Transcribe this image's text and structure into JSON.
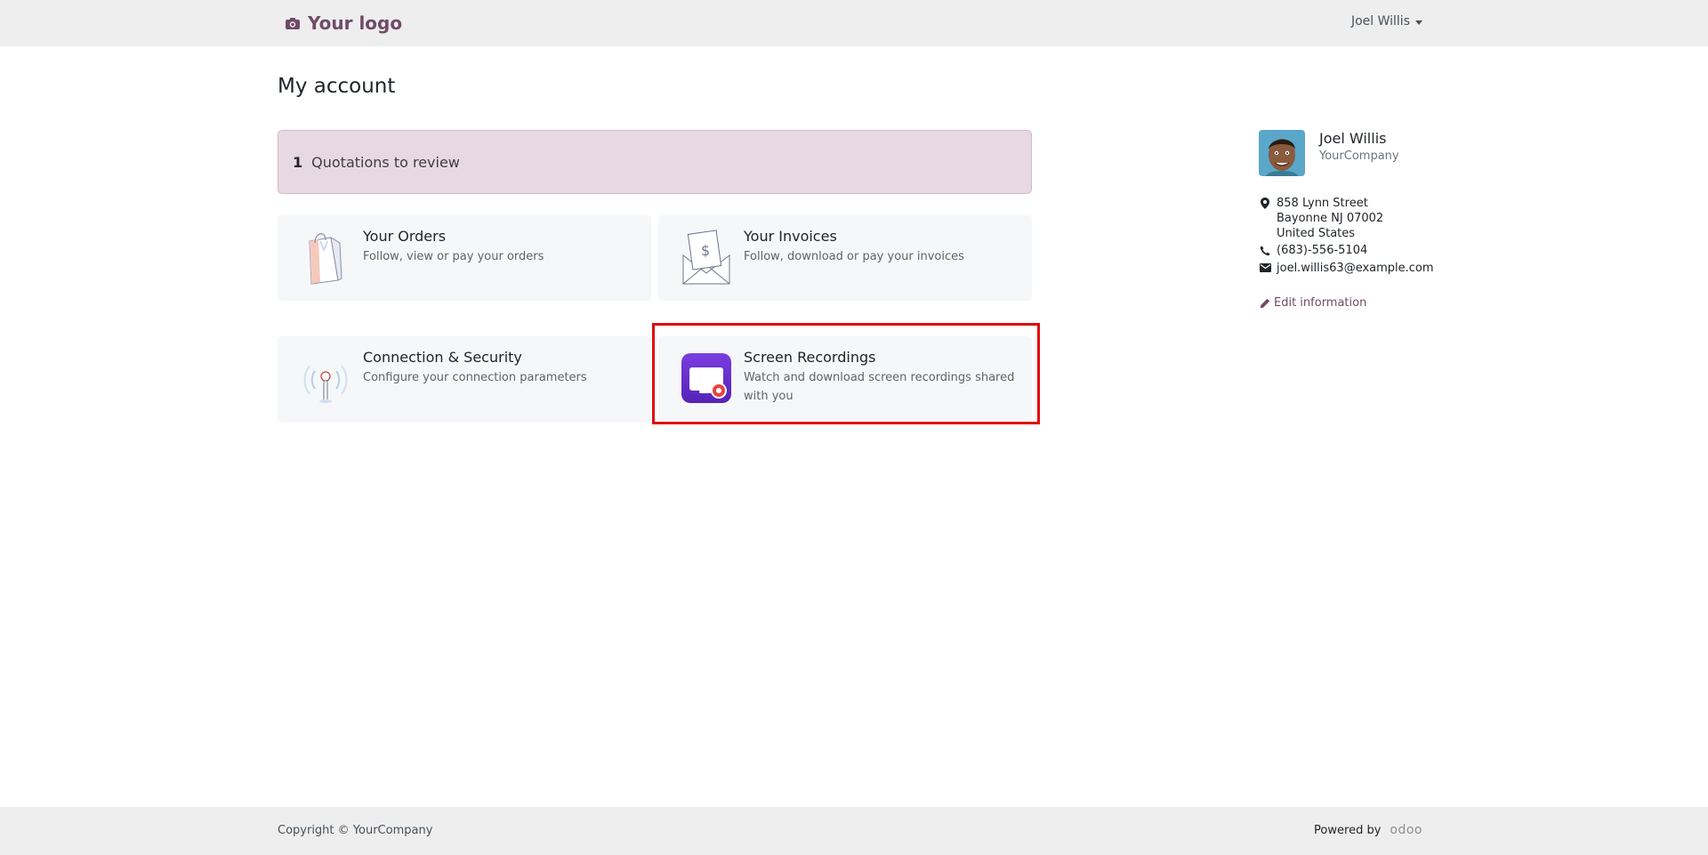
{
  "header": {
    "logo_text": "Your logo",
    "user_name": "Joel Willis"
  },
  "page": {
    "title": "My account"
  },
  "alert": {
    "count": "1",
    "label": "Quotations to review"
  },
  "cards": [
    {
      "title": "Your Orders",
      "desc": "Follow, view or pay your orders",
      "icon": "shopping-bag-icon"
    },
    {
      "title": "Your Invoices",
      "desc": "Follow, download or pay your invoices",
      "icon": "invoice-envelope-icon"
    },
    {
      "title": "Connection & Security",
      "desc": "Configure your connection parameters",
      "icon": "antenna-icon"
    },
    {
      "title": "Screen Recordings",
      "desc": "Watch and download screen recordings shared with you",
      "icon": "screen-recording-icon"
    }
  ],
  "profile": {
    "name": "Joel Willis",
    "company": "YourCompany",
    "address_line1": "858 Lynn Street",
    "address_line2": "Bayonne NJ 07002",
    "address_line3": "United States",
    "phone": "(683)-556-5104",
    "email": "joel.willis63@example.com",
    "edit_label": "Edit information"
  },
  "footer": {
    "copyright": "Copyright © YourCompany",
    "powered_by": "Powered by",
    "brand": "odoo"
  },
  "colors": {
    "brand": "#714b67",
    "alert_bg": "#e7d9e3",
    "highlight": "#e00b0b",
    "recording_purple": "#6a2fd4",
    "recording_red": "#e8423f"
  }
}
